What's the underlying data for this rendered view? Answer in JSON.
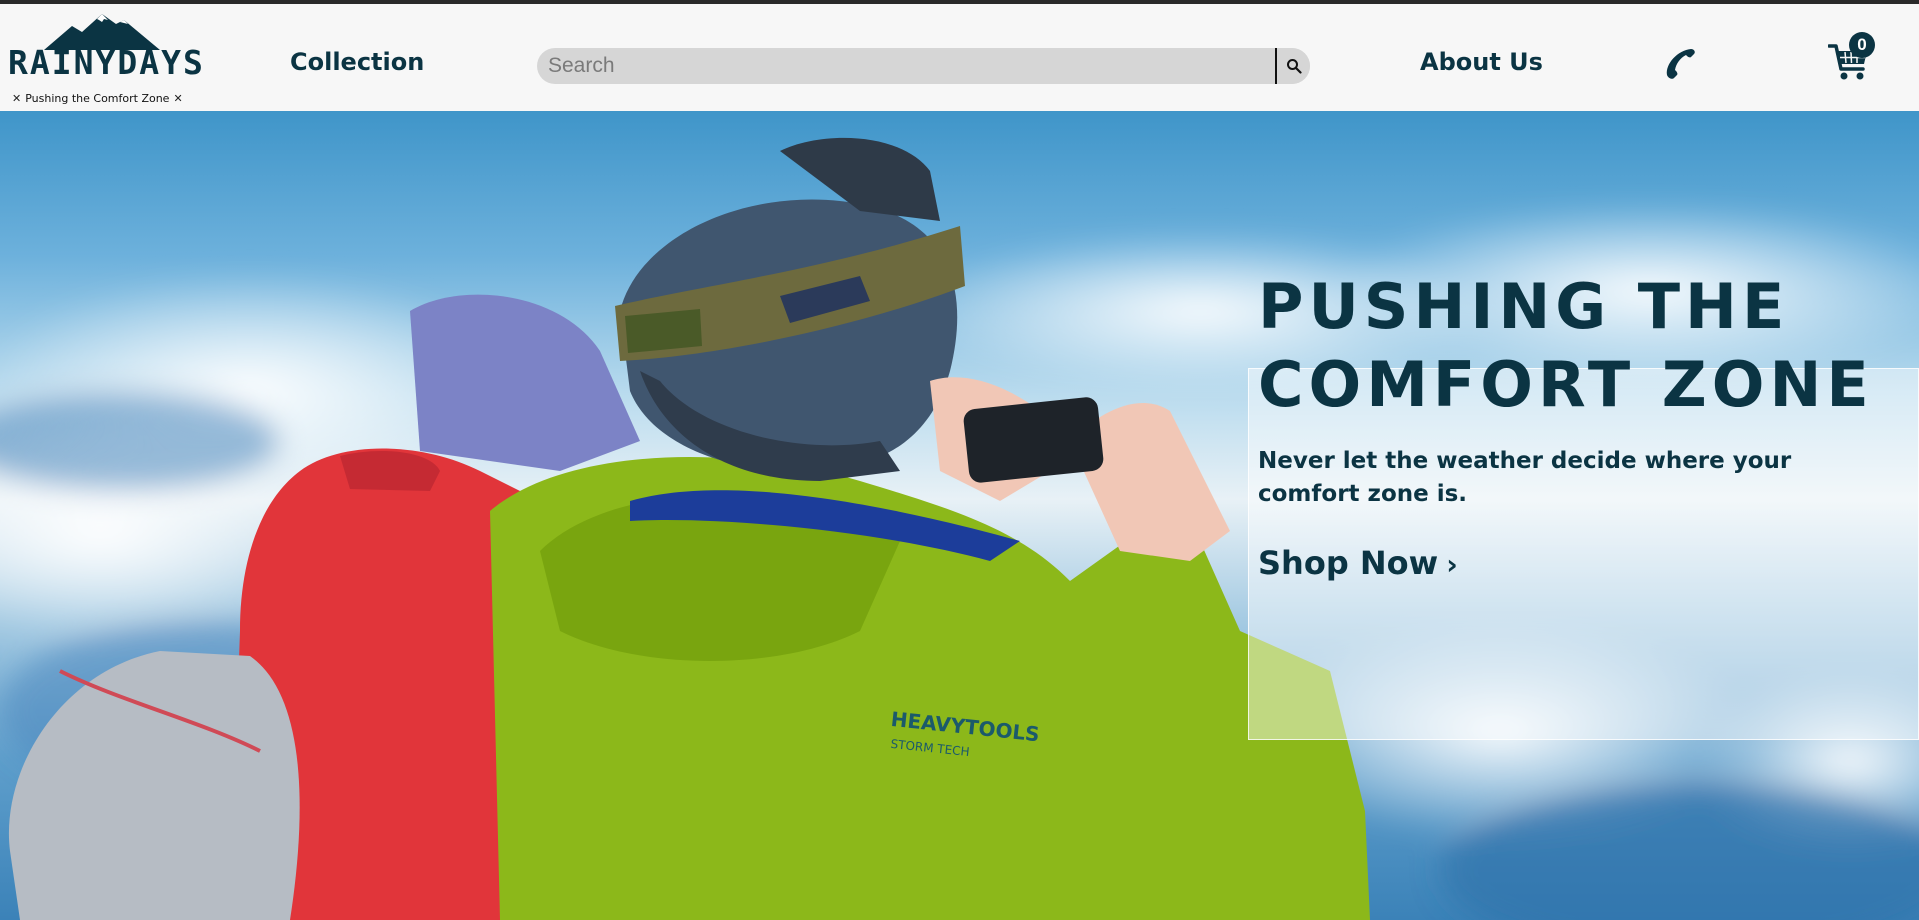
{
  "header": {
    "logo": {
      "brand": "RAINYDAYS",
      "tagline": "Pushing the Comfort Zone",
      "tagline_mark": "✕"
    },
    "nav": {
      "collection": "Collection",
      "about": "About Us"
    },
    "search": {
      "placeholder": "Search",
      "value": ""
    },
    "cart": {
      "count": "0"
    },
    "icons": [
      "mountain-logo-icon",
      "search-icon",
      "phone-icon",
      "cart-icon"
    ]
  },
  "hero": {
    "title": "PUSHING THE COMFORT ZONE",
    "subtitle": "Never let the weather decide where your comfort zone is.",
    "cta": "Shop Now",
    "cta_icon": "›"
  },
  "colors": {
    "brand": "#0b3443",
    "header_bg": "#f7f7f7",
    "search_bg": "#d6d6d6",
    "overlay": "rgba(255,255,255,0.45)"
  }
}
